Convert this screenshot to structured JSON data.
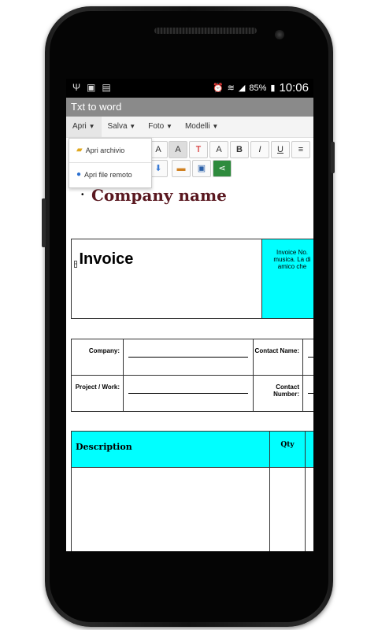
{
  "status_bar": {
    "battery": "85%",
    "time": "10:06"
  },
  "app": {
    "title": "Txt to word"
  },
  "menu": {
    "items": [
      {
        "label": "Apri"
      },
      {
        "label": "Salva"
      },
      {
        "label": "Foto"
      },
      {
        "label": "Modelli"
      }
    ]
  },
  "dropdown": {
    "items": [
      {
        "label": "Apri archivio",
        "icon": "folder-icon"
      },
      {
        "label": "Apri file remoto",
        "icon": "globe-icon"
      }
    ]
  },
  "toolbar": {
    "buttons": [
      "A",
      "A",
      "T",
      "A",
      "B",
      "I",
      "U"
    ]
  },
  "document": {
    "company_name": "Company name",
    "invoice_title": "Invoice",
    "invoice_note": "Invoice No.\nmusica. La di\namico che",
    "info": {
      "company_label": "Company:",
      "contact_name_label": "Contact Name:",
      "project_label": "Project / Work:",
      "contact_number_label": "Contact Number:"
    },
    "items_table": {
      "description_header": "Description",
      "qty_header": "Qty"
    },
    "colors": {
      "accent": "#00ffff",
      "company": "#5a1820"
    }
  }
}
